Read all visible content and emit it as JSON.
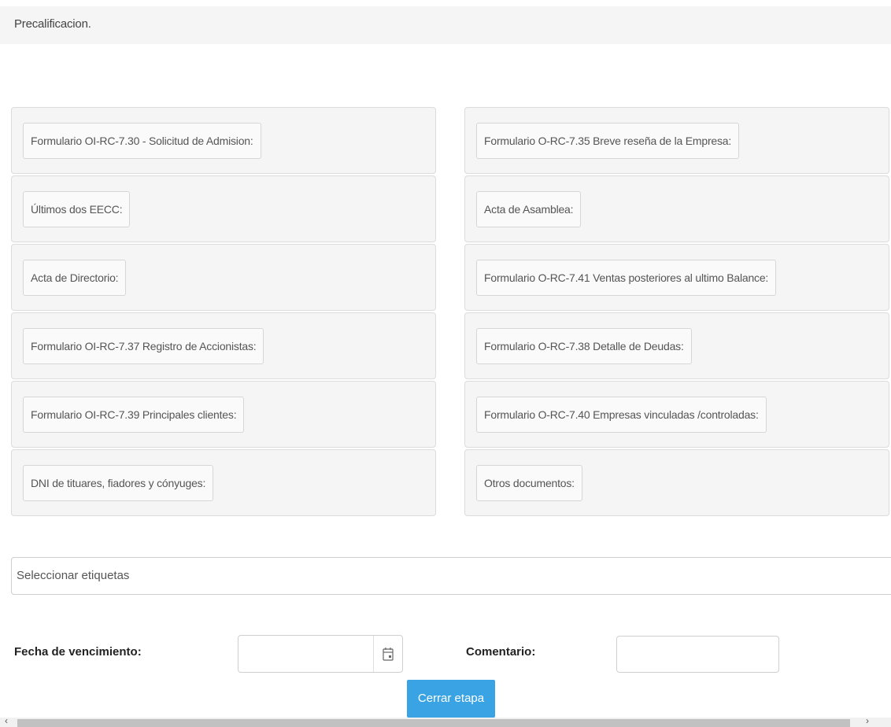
{
  "header": {
    "title": "Precalificacion."
  },
  "documents": {
    "left": [
      "Formulario OI-RC-7.30 - Solicitud de Admision:",
      "Últimos dos EECC:",
      "Acta de Directorio:",
      "Formulario OI-RC-7.37 Registro de Accionistas:",
      "Formulario OI-RC-7.39 Principales clientes:",
      "DNI de tituares, fiadores y cónyuges:"
    ],
    "right": [
      "Formulario O-RC-7.35 Breve reseña de la Empresa:",
      "Acta de Asamblea:",
      "Formulario O-RC-7.41 Ventas posteriores al ultimo Balance:",
      "Formulario O-RC-7.38 Detalle de Deudas:",
      "Formulario O-RC-7.40 Empresas vinculadas /controladas:",
      "Otros documentos:"
    ]
  },
  "tags": {
    "placeholder": "Seleccionar etiquetas"
  },
  "form": {
    "fecha_label": "Fecha de vencimiento:",
    "fecha_value": "",
    "comentario_label": "Comentario:",
    "comentario_value": ""
  },
  "actions": {
    "close_stage": "Cerrar etapa"
  },
  "colors": {
    "primary": "#3aa3e3",
    "panel_bg": "#f5f5f5",
    "border": "#dcdcdc"
  }
}
